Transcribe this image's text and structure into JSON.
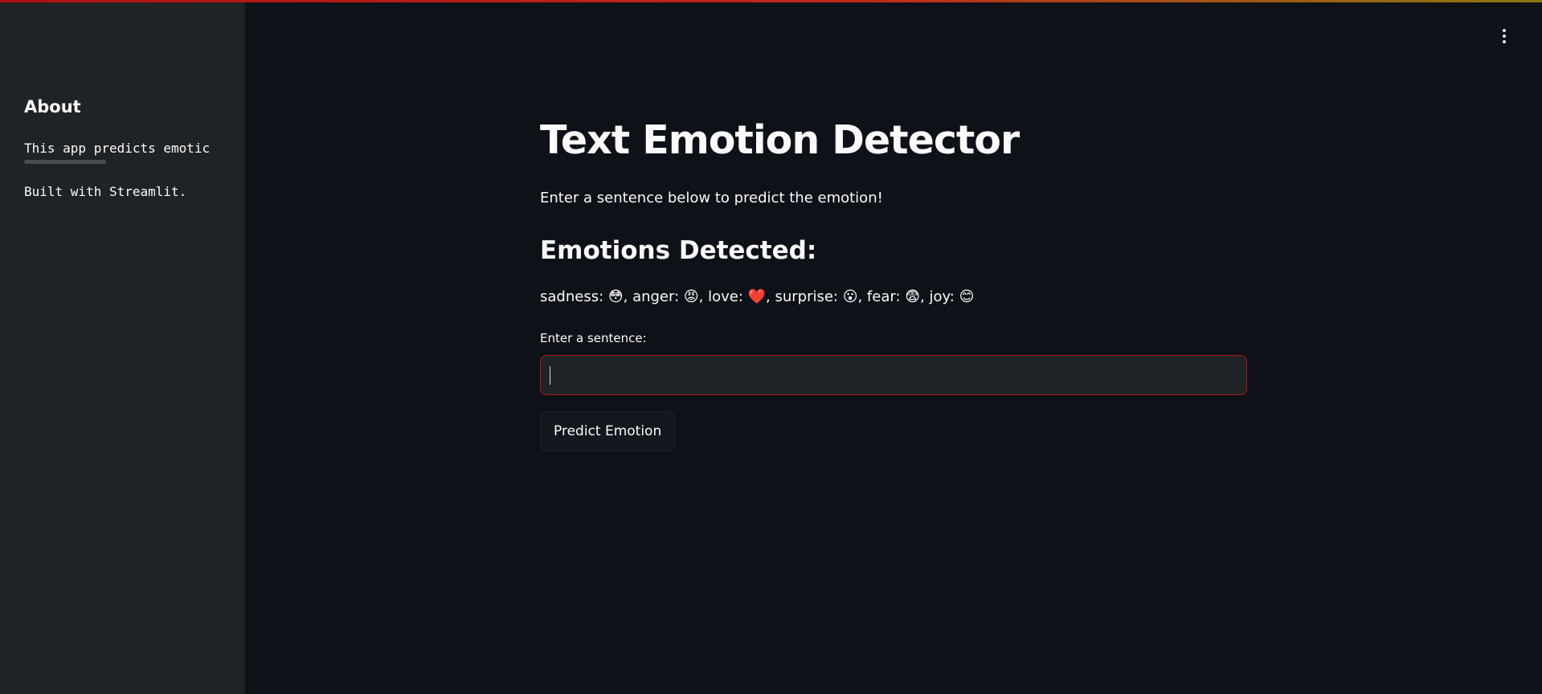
{
  "sidebar": {
    "heading": "About",
    "description": "This app predicts emotic",
    "built_with": "Built with Streamlit."
  },
  "header": {
    "menu_icon": "vertical-dots-icon"
  },
  "main": {
    "title": "Text Emotion Detector",
    "subtitle": "Enter a sentence below to predict the emotion!",
    "emotions_heading": "Emotions Detected:",
    "emotions_line": "sadness: 😳, anger: 😡, love: ❤️, surprise: 😮, fear: 😨, joy: 😊",
    "input_label": "Enter a sentence:",
    "input_value": "",
    "button_label": "Predict Emotion"
  },
  "colors": {
    "background": "#0e1117",
    "sidebar": "#202326",
    "input_border_focus": "#a61b1b",
    "text": "#fafafa"
  }
}
